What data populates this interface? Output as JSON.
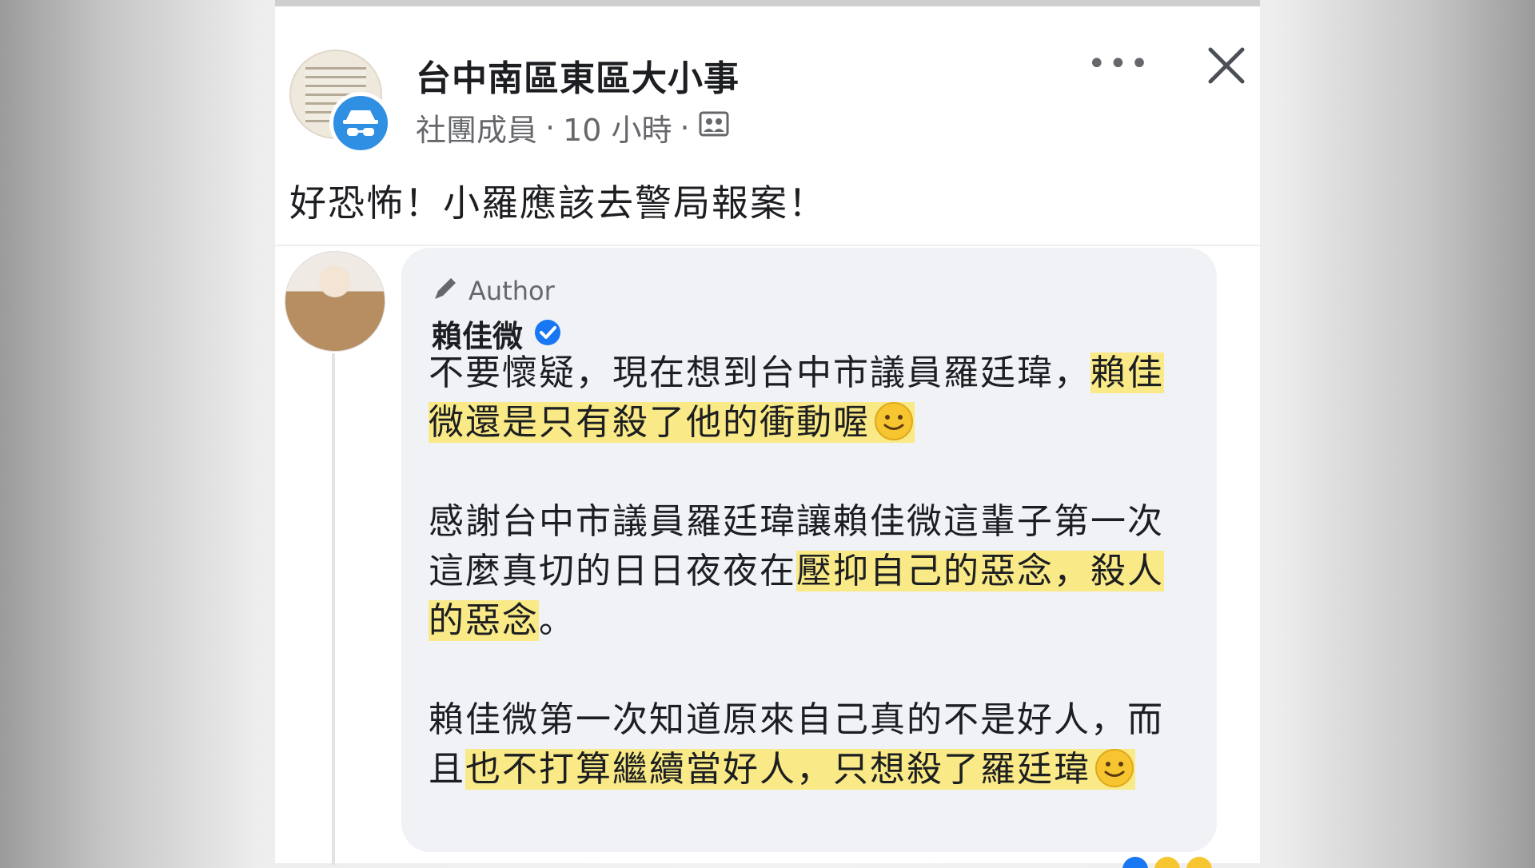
{
  "group": {
    "name": "台中南區東區大小事",
    "member_label": "社團成員",
    "time": "10 小時"
  },
  "post": {
    "text": "好恐怖！小羅應該去警局報案！"
  },
  "comment": {
    "author_tag": "Author",
    "name": "賴佳微",
    "paragraphs": [
      {
        "plain": "不要懷疑，現在想到台中市議員羅廷瑋，",
        "highlight": "賴佳微還是只有殺了他的衝動喔",
        "after": ""
      },
      {
        "plain": "感謝台中市議員羅廷瑋讓賴佳微這輩子第一次這麼真切的日日夜夜在",
        "highlight": "壓抑自己的惡念，殺人的惡念",
        "after": "。"
      },
      {
        "plain": "賴佳微第一次知道原來自己真的不是好人，而且",
        "highlight": "也不打算繼續當好人，只想殺了羅廷瑋",
        "after": ""
      }
    ]
  },
  "icons": {
    "more": "more-options-icon",
    "close": "close-icon",
    "audience": "group-audience-icon",
    "anon": "anonymous-member-icon",
    "pencil": "pencil-icon",
    "verified": "verified-badge-icon",
    "smile": "slightly-smiling-face-emoji"
  },
  "colors": {
    "highlight": "#f9e987",
    "verified": "#1877f2",
    "anon_badge": "#2f8fe3",
    "secondary_text": "#65676b",
    "bubble": "#f0f2f5"
  }
}
